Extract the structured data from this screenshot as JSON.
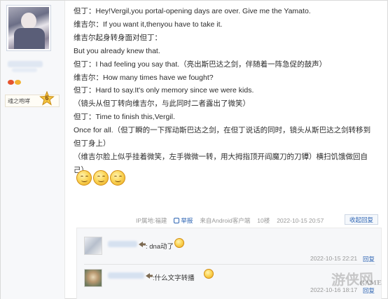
{
  "rank": {
    "name": "魂之咆哮",
    "level": "6"
  },
  "post": {
    "lines": [
      "但丁：Hey!Vergil,you portal-opening days are over. Give me the Yamato.",
      "维吉尔：If you want it,thenyou have to take it.",
      "维吉尔起身转身面对但丁：",
      "But you already knew that.",
      "但丁：I had feeling you say that.（亮出斯巴达之剑，伴随着一阵急促的鼓声）",
      "维吉尔：How many times have we fought?",
      "但丁：Hard to say.It's only memory since we were kids.",
      "（镜头从但丁转向维吉尔，与此同时二者露出了微笑）",
      "但丁：Time to finish this,Vergil.",
      "Once for all.（但丁瞬的一下挥动斯巴达之剑，在但丁说话的同时，镜头从斯巴达之剑转移到",
      "但丁身上）",
      "（维吉尔脸上似乎挂着微笑，左手微微一转，用大拇指顶开阎魔刀的刀镡）横扫饥饿做回自",
      "己）"
    ]
  },
  "meta": {
    "ip_location": "IP属地:福建",
    "report": "举报",
    "client": "来自Android客户端",
    "floor": "10楼",
    "time": "2022-10-15 20:57",
    "collapse_reply": "收起回复"
  },
  "replies": [
    {
      "text": ": dna动了",
      "time": "2022-10-15 22:21",
      "reply_label": "回复"
    },
    {
      "text": ":什么文字转播",
      "time": "2022-10-16 18:17",
      "reply_label": "回复"
    }
  ],
  "watermark": {
    "text": "游侠网",
    "sub": "GAME"
  }
}
